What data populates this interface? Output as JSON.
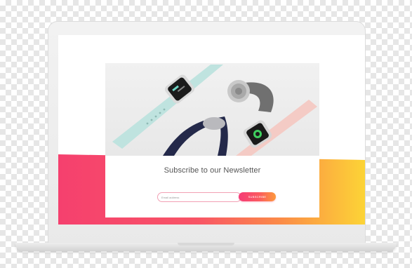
{
  "newsletter": {
    "title": "Subscribe to our Newsletter",
    "email_placeholder": "Email address",
    "subscribe_label": "SUBSCRIBE"
  },
  "hero": {
    "product": "smart watches"
  },
  "colors": {
    "band_left": "#f5406e",
    "band_mid": "#fa6a4e",
    "band_right": "#fcd436",
    "accent": "#f53b77",
    "strap_teal": "#bfe3df",
    "strap_navy": "#24294a",
    "strap_pink": "#f4cbc5",
    "strap_grey": "#707070"
  },
  "icons": {
    "watch_face_sport": "watch-face-icon",
    "watch_face_activity": "activity-icon"
  }
}
